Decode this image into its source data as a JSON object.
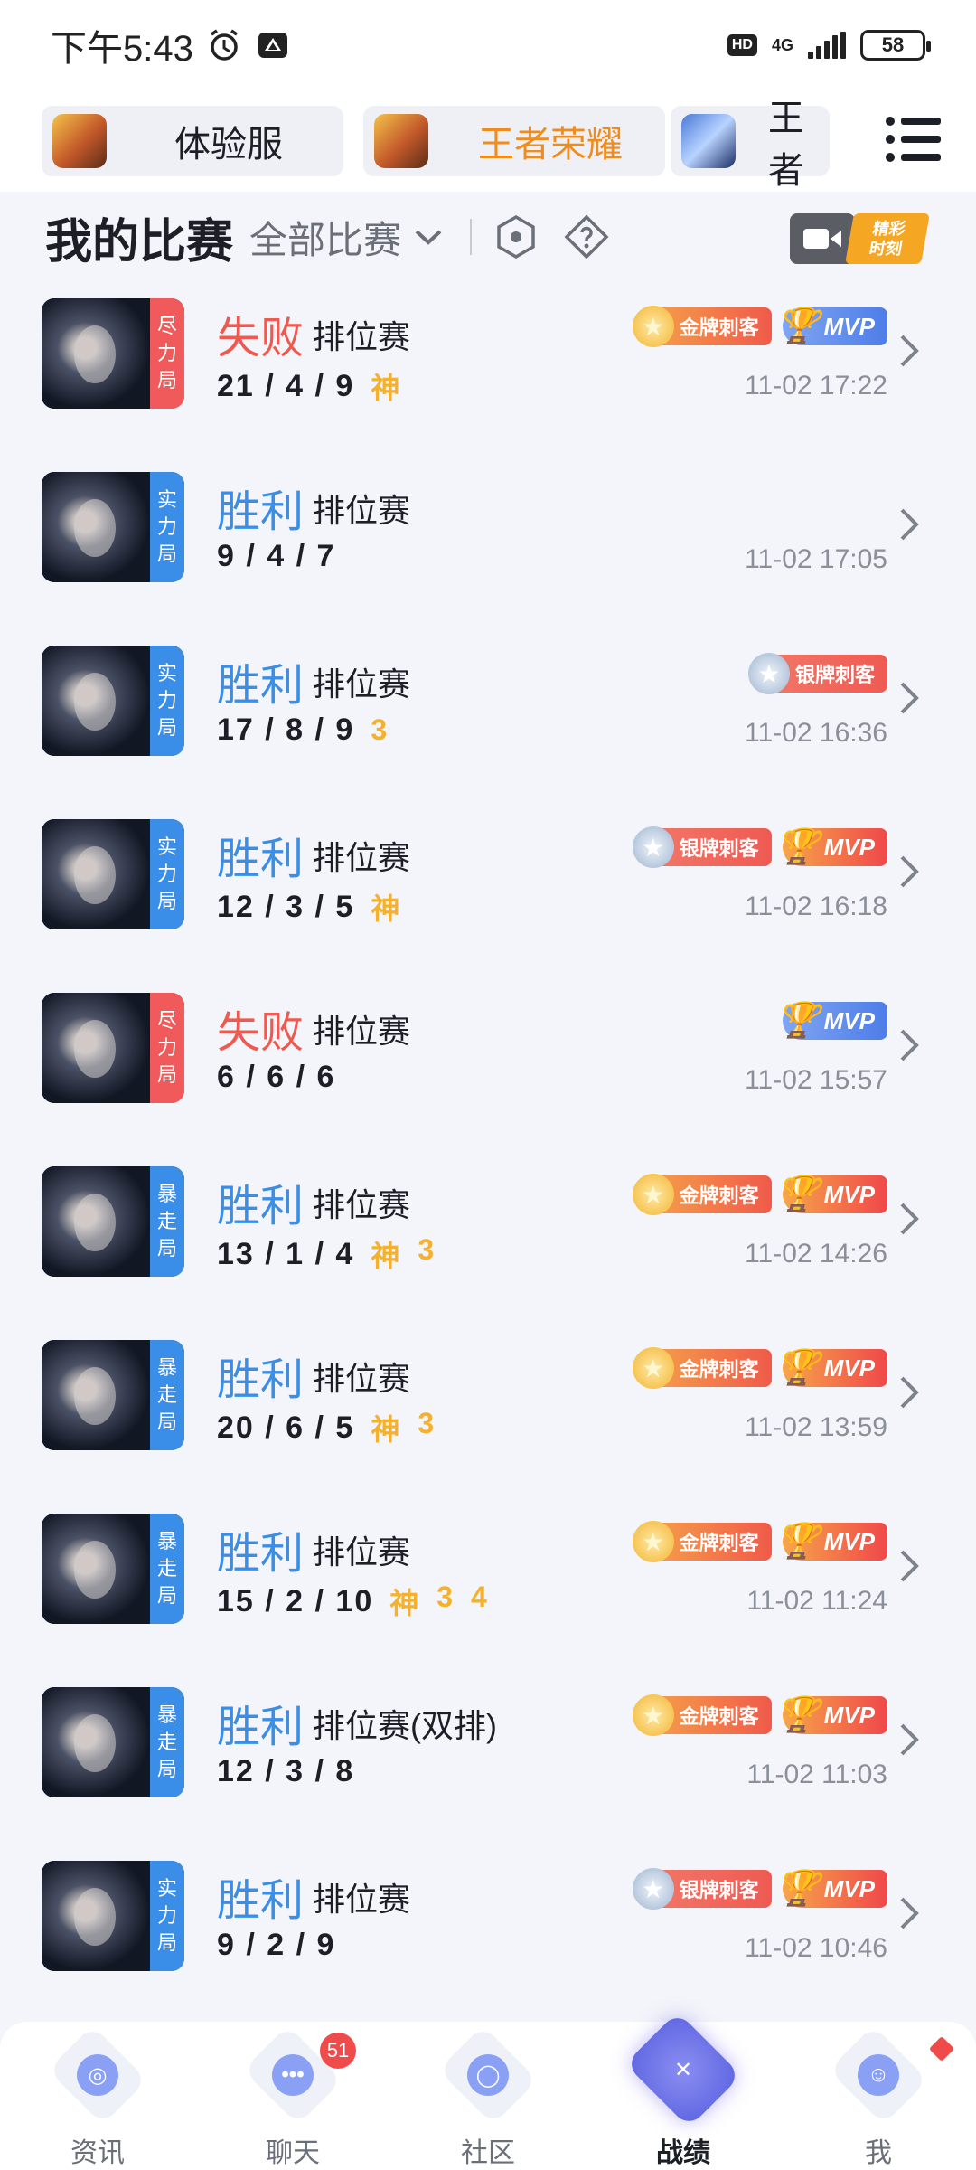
{
  "status_bar": {
    "time": "下午5:43",
    "hd": "HD",
    "network": "4G",
    "battery": "58"
  },
  "game_tabs": [
    {
      "label": "体验服",
      "icon": "game-icon-hero-gold"
    },
    {
      "label": "王者荣耀",
      "icon": "game-icon-hero-gold",
      "active": true
    },
    {
      "label": "王者",
      "icon": "game-icon-hero-blue"
    }
  ],
  "header": {
    "title": "我的比赛",
    "filter": "全部比赛",
    "highlight_top": "精彩",
    "highlight_bottom": "时刻"
  },
  "matches": [
    {
      "result": "失败",
      "outcome": "lose",
      "mode": "排位赛",
      "kda": "21 / 4 / 9",
      "tags": [
        "神"
      ],
      "time": "11-02 17:22",
      "badge": [
        "尽",
        "力",
        "局"
      ],
      "badge_color": "red",
      "medals": [
        {
          "type": "gold",
          "label": "金牌刺客"
        },
        {
          "type": "mvp-blue",
          "label": "MVP"
        }
      ]
    },
    {
      "result": "胜利",
      "outcome": "win",
      "mode": "排位赛",
      "kda": "9 / 4 / 7",
      "tags": [],
      "time": "11-02 17:05",
      "badge": [
        "实",
        "力",
        "局"
      ],
      "badge_color": "blue",
      "medals": []
    },
    {
      "result": "胜利",
      "outcome": "win",
      "mode": "排位赛",
      "kda": "17 / 8 / 9",
      "tags": [
        "3"
      ],
      "time": "11-02 16:36",
      "badge": [
        "实",
        "力",
        "局"
      ],
      "badge_color": "blue",
      "medals": [
        {
          "type": "silver",
          "label": "银牌刺客"
        }
      ]
    },
    {
      "result": "胜利",
      "outcome": "win",
      "mode": "排位赛",
      "kda": "12 / 3 / 5",
      "tags": [
        "神"
      ],
      "time": "11-02 16:18",
      "badge": [
        "实",
        "力",
        "局"
      ],
      "badge_color": "blue",
      "medals": [
        {
          "type": "silver",
          "label": "银牌刺客"
        },
        {
          "type": "mvp-gold",
          "label": "MVP"
        }
      ]
    },
    {
      "result": "失败",
      "outcome": "lose",
      "mode": "排位赛",
      "kda": "6 / 6 / 6",
      "tags": [],
      "time": "11-02 15:57",
      "badge": [
        "尽",
        "力",
        "局"
      ],
      "badge_color": "red",
      "medals": [
        {
          "type": "mvp-blue",
          "label": "MVP"
        }
      ]
    },
    {
      "result": "胜利",
      "outcome": "win",
      "mode": "排位赛",
      "kda": "13 / 1 / 4",
      "tags": [
        "神",
        "3"
      ],
      "time": "11-02 14:26",
      "badge": [
        "暴",
        "走",
        "局"
      ],
      "badge_color": "blue",
      "medals": [
        {
          "type": "gold",
          "label": "金牌刺客"
        },
        {
          "type": "mvp-gold",
          "label": "MVP"
        }
      ]
    },
    {
      "result": "胜利",
      "outcome": "win",
      "mode": "排位赛",
      "kda": "20 / 6 / 5",
      "tags": [
        "神",
        "3"
      ],
      "time": "11-02 13:59",
      "badge": [
        "暴",
        "走",
        "局"
      ],
      "badge_color": "blue",
      "medals": [
        {
          "type": "gold",
          "label": "金牌刺客"
        },
        {
          "type": "mvp-gold",
          "label": "MVP"
        }
      ]
    },
    {
      "result": "胜利",
      "outcome": "win",
      "mode": "排位赛",
      "kda": "15 / 2 / 10",
      "tags": [
        "神",
        "3",
        "4"
      ],
      "time": "11-02 11:24",
      "badge": [
        "暴",
        "走",
        "局"
      ],
      "badge_color": "blue",
      "medals": [
        {
          "type": "gold",
          "label": "金牌刺客"
        },
        {
          "type": "mvp-gold",
          "label": "MVP"
        }
      ]
    },
    {
      "result": "胜利",
      "outcome": "win",
      "mode": "排位赛(双排)",
      "kda": "12 / 3 / 8",
      "tags": [],
      "time": "11-02 11:03",
      "badge": [
        "暴",
        "走",
        "局"
      ],
      "badge_color": "blue",
      "medals": [
        {
          "type": "gold",
          "label": "金牌刺客"
        },
        {
          "type": "mvp-gold",
          "label": "MVP"
        }
      ]
    },
    {
      "result": "胜利",
      "outcome": "win",
      "mode": "排位赛",
      "kda": "9 / 2 / 9",
      "tags": [],
      "time": "11-02 10:46",
      "badge": [
        "实",
        "力",
        "局"
      ],
      "badge_color": "blue",
      "medals": [
        {
          "type": "silver",
          "label": "银牌刺客"
        },
        {
          "type": "mvp-gold",
          "label": "MVP"
        }
      ]
    }
  ],
  "bottom_nav": [
    {
      "label": "资讯",
      "icon": "news-icon",
      "color": "#8aa0f5"
    },
    {
      "label": "聊天",
      "icon": "chat-icon",
      "color": "#8aa0f5",
      "badge": "51"
    },
    {
      "label": "社区",
      "icon": "community-icon",
      "color": "#8aa0f5"
    },
    {
      "label": "战绩",
      "icon": "battle-record-icon",
      "color": "#ffffff",
      "active": true
    },
    {
      "label": "我",
      "icon": "profile-icon",
      "color": "#8aa0f5",
      "dot": true
    }
  ]
}
